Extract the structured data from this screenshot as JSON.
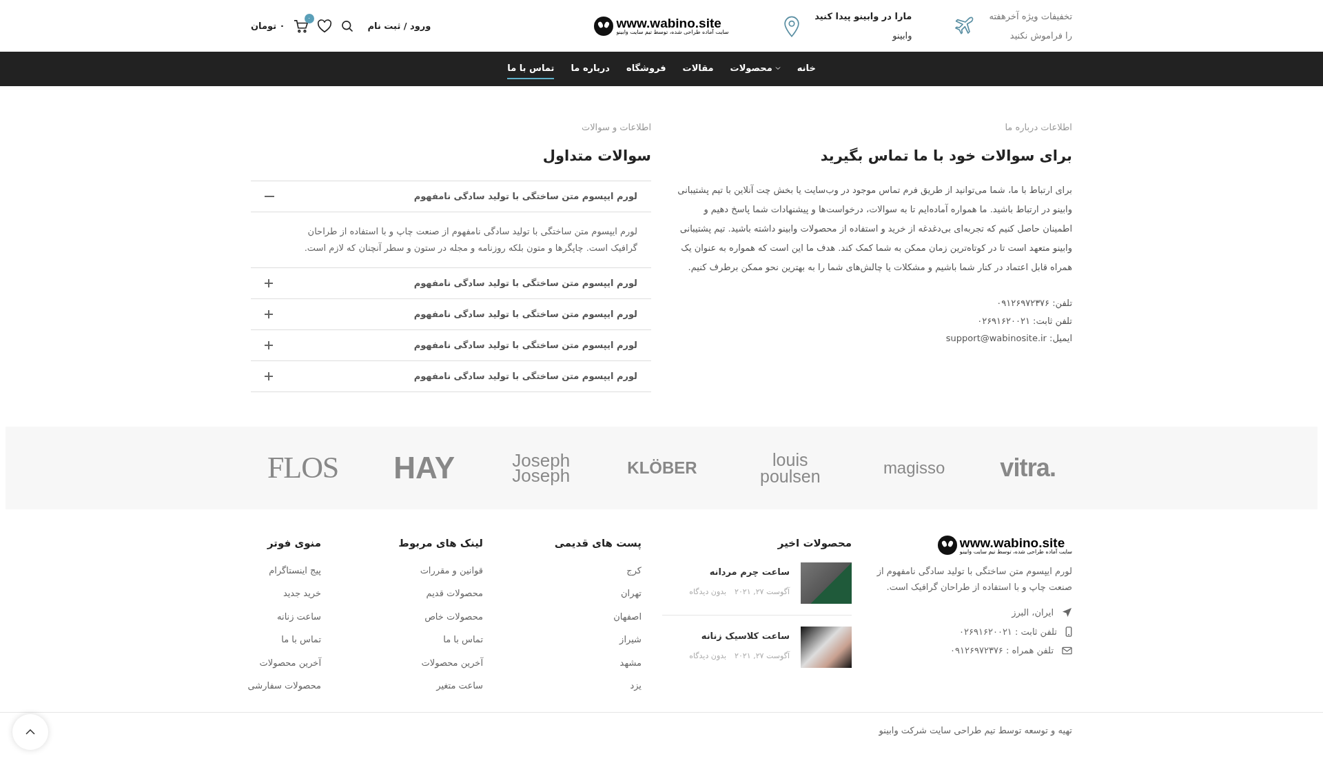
{
  "header": {
    "promo": {
      "line1": "تخفیفات ویژه آخرهفته",
      "line2": "را فراموش نکنید"
    },
    "location": {
      "line1": "مارا در وابینو پیدا کنید",
      "line2": "وابینو"
    },
    "logo": {
      "url": "www.wabino.site",
      "tagline": "سایت آماده طراحی شده، توسط تیم سایت وابینو"
    },
    "login": "ورود / ثبت نام",
    "cart_badge": "۰",
    "cart_total": "۰ تومان"
  },
  "nav": [
    {
      "label": "خانه",
      "selected": false,
      "dropdown": false
    },
    {
      "label": "محصولات",
      "selected": false,
      "dropdown": true
    },
    {
      "label": "مقالات",
      "selected": false,
      "dropdown": false
    },
    {
      "label": "فروشگاه",
      "selected": false,
      "dropdown": false
    },
    {
      "label": "درباره ما",
      "selected": false,
      "dropdown": false
    },
    {
      "label": "تماس با ما",
      "selected": true,
      "dropdown": false
    }
  ],
  "contact": {
    "eyebrow": "اطلاعات درباره ما",
    "heading": "برای سوالات خود با ما تماس بگیرید",
    "paragraph": "برای ارتباط با ما، شما می‌توانید از طریق فرم تماس موجود در وب‌سایت یا بخش چت آنلاین با تیم پشتیبانی وابینو در ارتباط باشید. ما همواره آماده‌ایم تا به سوالات، درخواست‌ها و پیشنهادات شما پاسخ دهیم و اطمینان حاصل کنیم که تجربه‌ای بی‌دغدغه از خرید و استفاده از محصولات وابینو داشته باشید. تیم پشتیبانی وابینو متعهد است تا در کوتاه‌ترین زمان ممکن به شما کمک کند. هدف ما این است که همواره به عنوان یک همراه قابل اعتماد در کنار شما باشیم و مشکلات یا چالش‌های شما را به بهترین نحو ممکن برطرف کنیم.",
    "details": [
      "تلفن: ۰۹۱۲۶۹۷۲۳۷۶",
      "تلفن ثابت: ۰۲۶۹۱۶۲۰۰۲۱",
      "ایمیل: support@wabinosite.ir"
    ]
  },
  "faq": {
    "eyebrow": "اطلاعات و سوالات",
    "heading": "سوالات متداول",
    "items": [
      {
        "question": "لورم ایپسوم متن ساختگی با تولید سادگی نامفهوم",
        "expanded": true,
        "answer": "لورم ایپسوم متن ساختگی با تولید سادگی نامفهوم از صنعت چاپ و با استفاده از طراحان گرافیک است. چاپگرها و متون بلکه روزنامه و مجله در ستون و سطر آنچنان که لازم است."
      },
      {
        "question": "لورم ایپسوم متن ساختگی با تولید سادگی نامفهوم",
        "expanded": false
      },
      {
        "question": "لورم ایپسوم متن ساختگی با تولید سادگی نامفهوم",
        "expanded": false
      },
      {
        "question": "لورم ایپسوم متن ساختگی با تولید سادگی نامفهوم",
        "expanded": false
      },
      {
        "question": "لورم ایپسوم متن ساختگی با تولید سادگی نامفهوم",
        "expanded": false
      }
    ]
  },
  "brands": [
    "vitra.",
    "magisso",
    "louis poulsen",
    "KLÖBER",
    "Joseph Joseph",
    "HAY",
    "FLOS"
  ],
  "footer": {
    "about": {
      "logo": {
        "url": "www.wabino.site",
        "tagline": "سایت آماده طراحی شده، توسط تیم سایت وابینو"
      },
      "text": "لورم ایپسوم متن ساختگی با تولید سادگی نامفهوم از صنعت چاپ و با استفاده از طراحان گرافیک است.",
      "contacts": [
        {
          "kind": "address",
          "text": "ایران، البرز"
        },
        {
          "kind": "phone",
          "text": "تلفن ثابت : ۰۲۶۹۱۶۲۰۰۲۱"
        },
        {
          "kind": "mail",
          "text": "تلفن همراه : ۰۹۱۲۶۹۷۲۳۷۶"
        }
      ]
    },
    "recent": {
      "title": "محصولات اخیر",
      "items": [
        {
          "name": "ساعت چرم مردانه",
          "date": "آگوست ۲۷, ۲۰۲۱",
          "comments": "بدون دیدگاه"
        },
        {
          "name": "ساعت کلاسیک زنانه",
          "date": "آگوست ۲۷, ۲۰۲۱",
          "comments": "بدون دیدگاه"
        }
      ]
    },
    "columns": [
      {
        "title": "پست های قدیمی",
        "links": [
          "کرج",
          "تهران",
          "اصفهان",
          "شیراز",
          "مشهد",
          "یزد"
        ]
      },
      {
        "title": "لینک های مربوط",
        "links": [
          "قوانین و مقررات",
          "محصولات قدیم",
          "محصولات خاص",
          "تماس با ما",
          "آخرین محصولات",
          "ساعت متغیر"
        ]
      },
      {
        "title": "منوی فوتر",
        "links": [
          "پیج اینستاگرام",
          "خرید جدید",
          "ساعت زنانه",
          "تماس با ما",
          "آخرین محصولات",
          "محصولات سفارشی"
        ]
      }
    ],
    "copyright": "تهیه و توسعه توسط تیم طراحی سایت شرکت وابینو"
  }
}
